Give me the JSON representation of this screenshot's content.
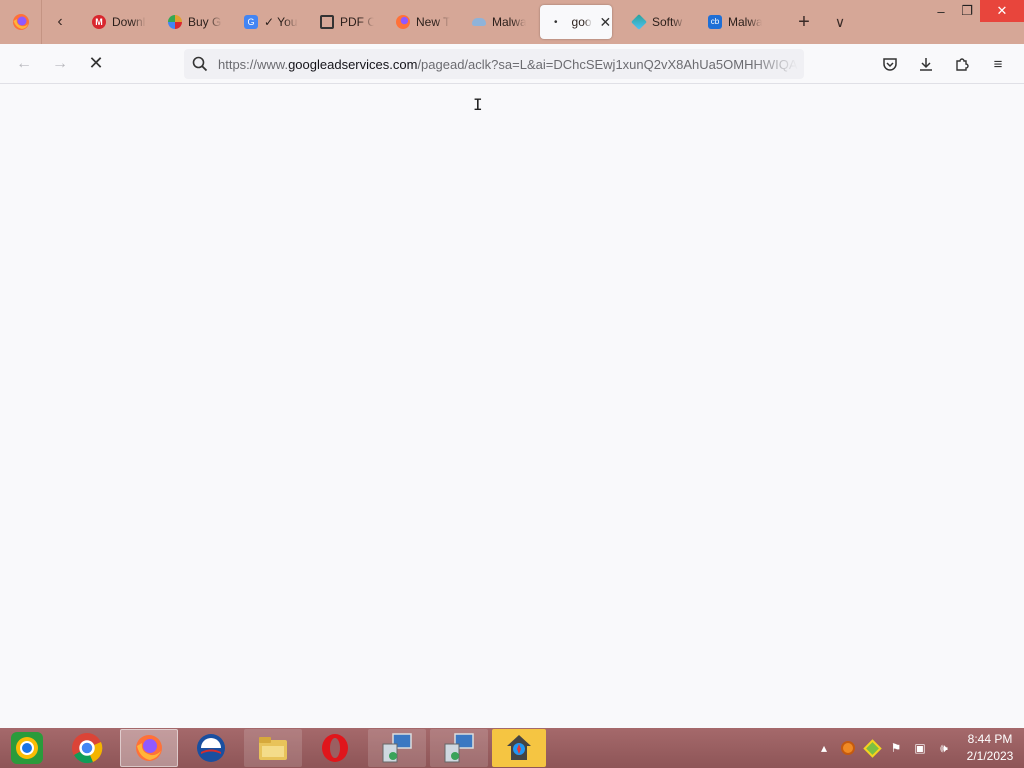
{
  "tabs": [
    {
      "label": "Downl",
      "favicon": "mega-icon",
      "color": "#d9272e"
    },
    {
      "label": "Buy Go",
      "favicon": "pinwheel-icon",
      "color": "#e0a030"
    },
    {
      "label": "✓ You",
      "favicon": "google-translate-icon",
      "color": "#4285f4"
    },
    {
      "label": "PDF C",
      "favicon": "printer-icon",
      "color": "#333333"
    },
    {
      "label": "New T",
      "favicon": "firefox-icon",
      "color": "#ff7139"
    },
    {
      "label": "Malwa",
      "favicon": "cloud-icon",
      "color": "#8fb3d9"
    },
    {
      "label": "goo",
      "favicon": "loading-dot-icon",
      "color": "#333333",
      "active": true
    },
    {
      "label": "Softw",
      "favicon": "gem-icon",
      "color": "#2aa198"
    },
    {
      "label": "Malwa",
      "favicon": "cb-icon",
      "color": "#1f6fd6"
    }
  ],
  "nav": {
    "url_prefix": "https://www.",
    "url_domain": "googleadservices.com",
    "url_rest": "/pagead/aclk?sa=L&ai=DChcSEwj1xunQ2vX8AhUa5OMHHWIQA"
  },
  "taskbar": {
    "apps": [
      "chrome-os-icon",
      "chrome-icon",
      "firefox-icon",
      "obama-icon",
      "file-explorer-icon",
      "opera-icon",
      "remote-desktop-icon",
      "remote-desktop-icon",
      "security-app-icon"
    ],
    "time": "8:44 PM",
    "date": "2/1/2023"
  },
  "colors": {
    "tabstrip": "#d6a797",
    "taskbar": "#9b5f61",
    "close": "#e8453c"
  }
}
